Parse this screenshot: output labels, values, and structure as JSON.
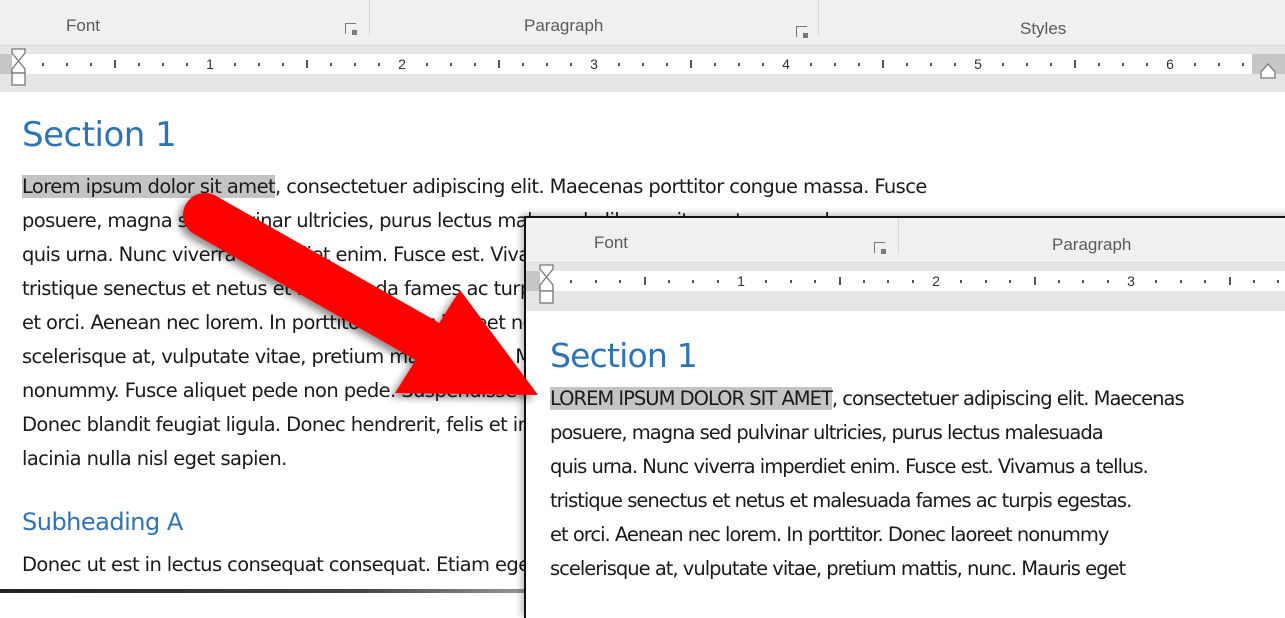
{
  "main_window": {
    "ribbon": {
      "groups": [
        {
          "label": "Font",
          "has_launcher": true
        },
        {
          "label": "Paragraph",
          "has_launcher": true
        },
        {
          "label": "Styles",
          "has_launcher": false
        }
      ]
    },
    "ruler": {
      "numbers": [
        "1",
        "2",
        "3",
        "4",
        "5",
        "6"
      ]
    },
    "document": {
      "heading": "Section 1",
      "paragraph_highlight": "Lorem ipsum dolor sit amet",
      "paragraph_lines": [
        ", consectetuer adipiscing elit. Maecenas porttitor congue massa. Fusce",
        "posuere, magna sed pulvinar ultricies, purus lectus malesuada libero, sit amet commodo magna eros",
        "quis urna. Nunc viverra imperdiet enim. Fusce est. Vivamus a tellus. Pellentesque habitant morbi",
        "tristique senectus et netus et malesuada fames ac turpis egestas. Proin pharetra nonummy pede. Mauris",
        "et orci. Aenean nec lorem. In porttitor. Donec laoreet nonummy augue. Suspendisse dui purus,",
        "scelerisque at, vulputate vitae, pretium mattis, nunc. Mauris eget neque at sem venenatis eleifend.",
        "nonummy. Fusce aliquet pede non pede. Suspendisse dapibus lorem pellentesque magna. Integer nulla.",
        "Donec blandit feugiat ligula. Donec hendrerit, felis et imperdiet euismod, purus ipsum pretium metus, in",
        "lacinia nulla nisl eget sapien."
      ],
      "subheading": "Subheading A",
      "subparagraph": "Donec ut est in lectus consequat consequat. Etiam eget dui."
    }
  },
  "inset_window": {
    "ribbon": {
      "groups": [
        {
          "label": "Font",
          "has_launcher": true
        },
        {
          "label": "Paragraph",
          "has_launcher": false
        }
      ]
    },
    "ruler": {
      "numbers": [
        "1",
        "2",
        "3"
      ]
    },
    "document": {
      "heading": "Section 1",
      "paragraph_highlight": "LOREM IPSUM DOLOR SIT AMET",
      "paragraph_lines": [
        ", consectetuer adipiscing elit. Maecenas",
        "posuere, magna sed pulvinar ultricies, purus lectus malesuada",
        "quis urna. Nunc viverra imperdiet enim. Fusce est. Vivamus a tellus.",
        "tristique senectus et netus et malesuada fames ac turpis egestas.",
        "et orci. Aenean nec lorem. In porttitor. Donec laoreet nonummy",
        "scelerisque at, vulputate vitae, pretium mattis, nunc. Mauris eget"
      ]
    }
  },
  "annotation": {
    "arrow_color": "#ff0000",
    "arrow_direction": "down-right"
  },
  "colors": {
    "heading": "#2e74b5",
    "highlight": "#c4c4c4",
    "ribbon_bg": "#f0f0f0"
  }
}
